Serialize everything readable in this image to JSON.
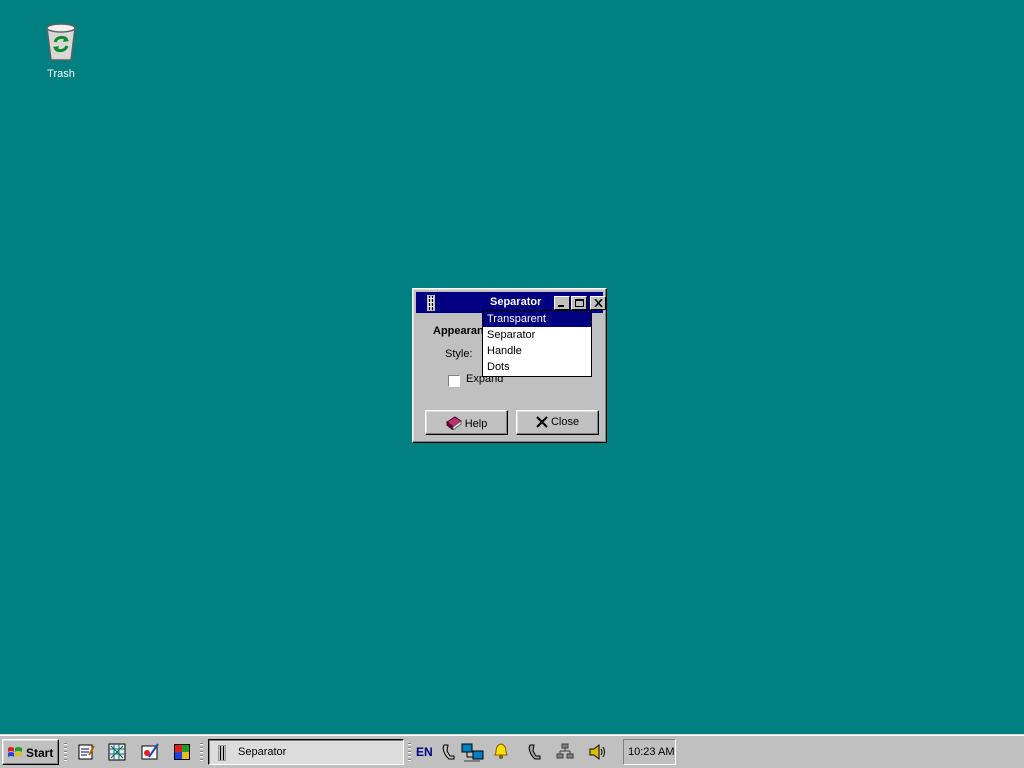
{
  "desktop": {
    "icons": [
      {
        "label": "Trash",
        "icon": "recycle-bin-icon"
      }
    ]
  },
  "dialog": {
    "title": "Separator",
    "group_label": "Appearan",
    "style_label": "Style:",
    "expand_label": "Expand",
    "expand_checked": false,
    "help_label": "Help",
    "close_label": "Close"
  },
  "dropdown": {
    "selected": "Transparent",
    "options": [
      "Transparent",
      "Separator",
      "Handle",
      "Dots"
    ]
  },
  "taskbar": {
    "start_label": "Start",
    "task_label": "Separator",
    "language": "EN",
    "clock": "10:23 AM"
  },
  "colors": {
    "desktop": "#008080",
    "titlebar": "#000080",
    "face": "#c0c0c0",
    "selection": "#000080"
  }
}
